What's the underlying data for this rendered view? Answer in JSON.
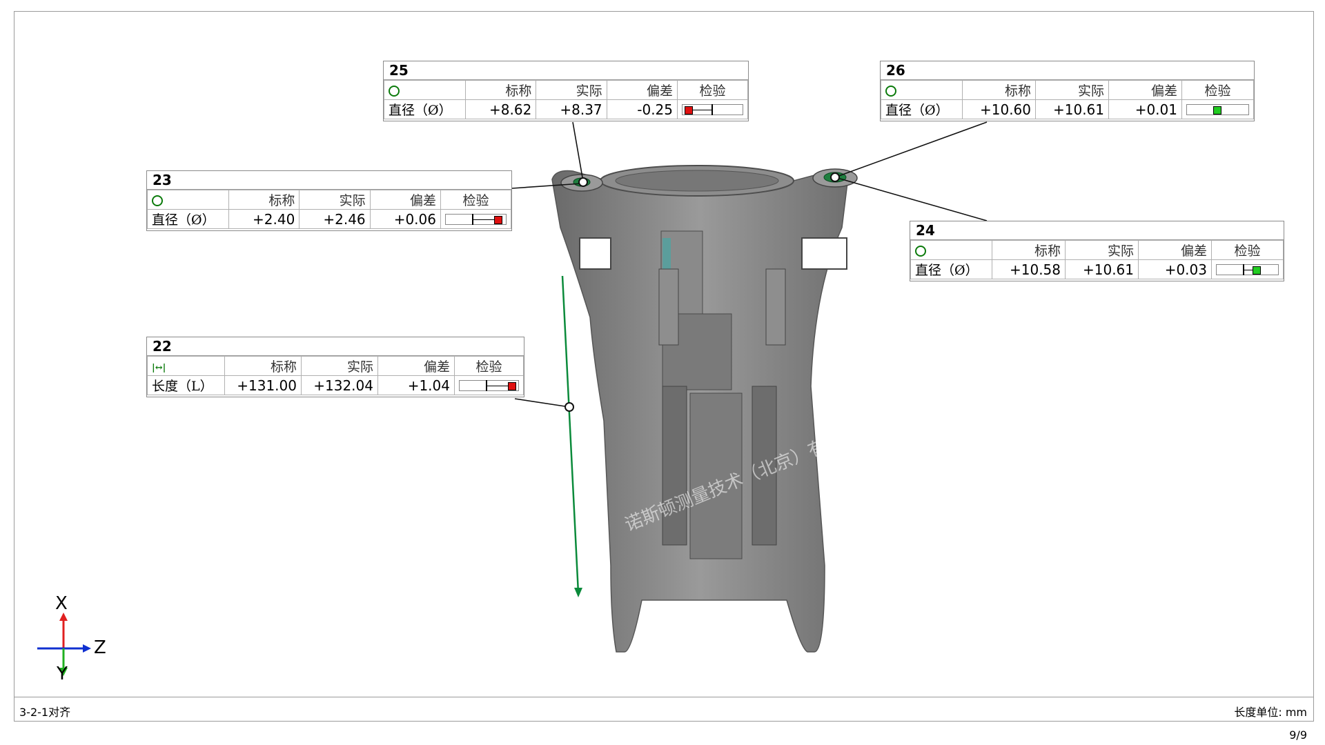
{
  "footer": {
    "alignment_label": "3-2-1对齐",
    "unit_label": "长度单位: mm",
    "page": "9/9"
  },
  "watermark": {
    "text": "诺斯顿测量技术（北京）有限公司"
  },
  "axes": {
    "up": "X",
    "right": "Z",
    "down": "Y"
  },
  "headers": {
    "nominal": "标称",
    "actual": "实际",
    "deviation": "偏差",
    "check": "检验"
  },
  "colors": {
    "out_of_tol": "#e01010",
    "in_tol": "#22cc22",
    "feature_line": "#0a8a3a",
    "icon": "#0a7a0a"
  },
  "callouts": {
    "c25": {
      "id": "25",
      "icon": "circle-icon",
      "label": "直径（Ø）",
      "nominal": "+8.62",
      "actual": "+8.37",
      "deviation": "-0.25",
      "status": "out-of-tolerance"
    },
    "c26": {
      "id": "26",
      "icon": "circle-icon",
      "label": "直径（Ø）",
      "nominal": "+10.60",
      "actual": "+10.61",
      "deviation": "+0.01",
      "status": "in-tolerance"
    },
    "c23": {
      "id": "23",
      "icon": "circle-icon",
      "label": "直径（Ø）",
      "nominal": "+2.40",
      "actual": "+2.46",
      "deviation": "+0.06",
      "status": "out-of-tolerance"
    },
    "c24": {
      "id": "24",
      "icon": "circle-icon",
      "label": "直径（Ø）",
      "nominal": "+10.58",
      "actual": "+10.61",
      "deviation": "+0.03",
      "status": "in-tolerance"
    },
    "c22": {
      "id": "22",
      "icon": "length-icon",
      "label": "长度（L）",
      "nominal": "+131.00",
      "actual": "+132.04",
      "deviation": "+1.04",
      "status": "out-of-tolerance"
    }
  }
}
